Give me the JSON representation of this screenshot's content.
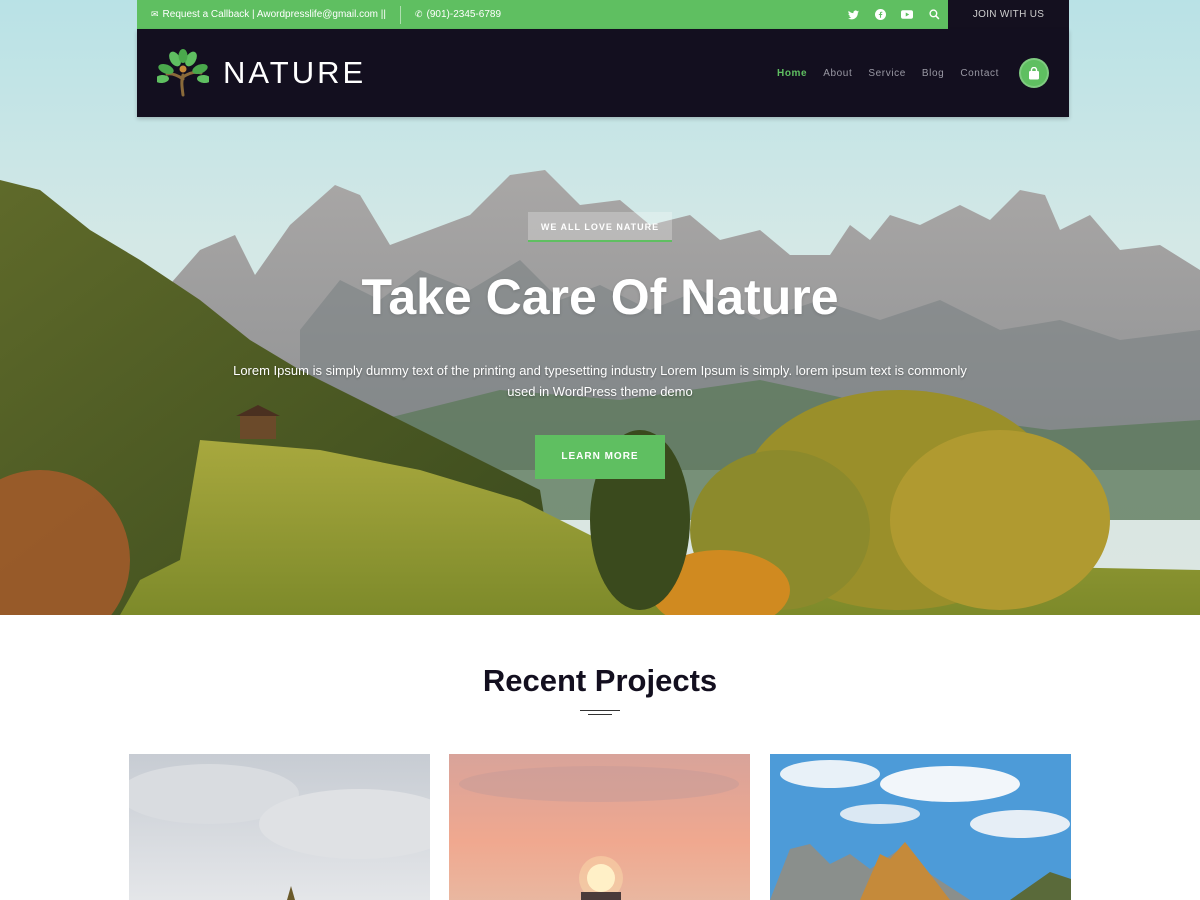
{
  "topbar": {
    "callback_text": "Request a Callback | Awordpresslife@gmail.com ||",
    "phone_text": "(901)-2345-6789",
    "social_icons": [
      "twitter-icon",
      "facebook-icon",
      "youtube-icon",
      "search-icon"
    ],
    "join_label": "JOIN WITH US",
    "accent_color": "#5fbf61"
  },
  "header": {
    "logo_text": "NATURE",
    "nav": [
      {
        "label": "Home",
        "active": true
      },
      {
        "label": "About",
        "active": false
      },
      {
        "label": "Service",
        "active": false
      },
      {
        "label": "Blog",
        "active": false
      },
      {
        "label": "Contact",
        "active": false
      }
    ],
    "cart_icon": "shopping-bag-icon",
    "background": "#130f1f"
  },
  "hero": {
    "tagline": "WE ALL LOVE NATURE",
    "title": "Take Care Of Nature",
    "description": "Lorem Ipsum is simply dummy text of the printing and typesetting industry Lorem Ipsum is simply. lorem ipsum text is commonly used in WordPress theme demo",
    "button_label": "LEARN MORE"
  },
  "projects": {
    "title": "Recent Projects"
  }
}
